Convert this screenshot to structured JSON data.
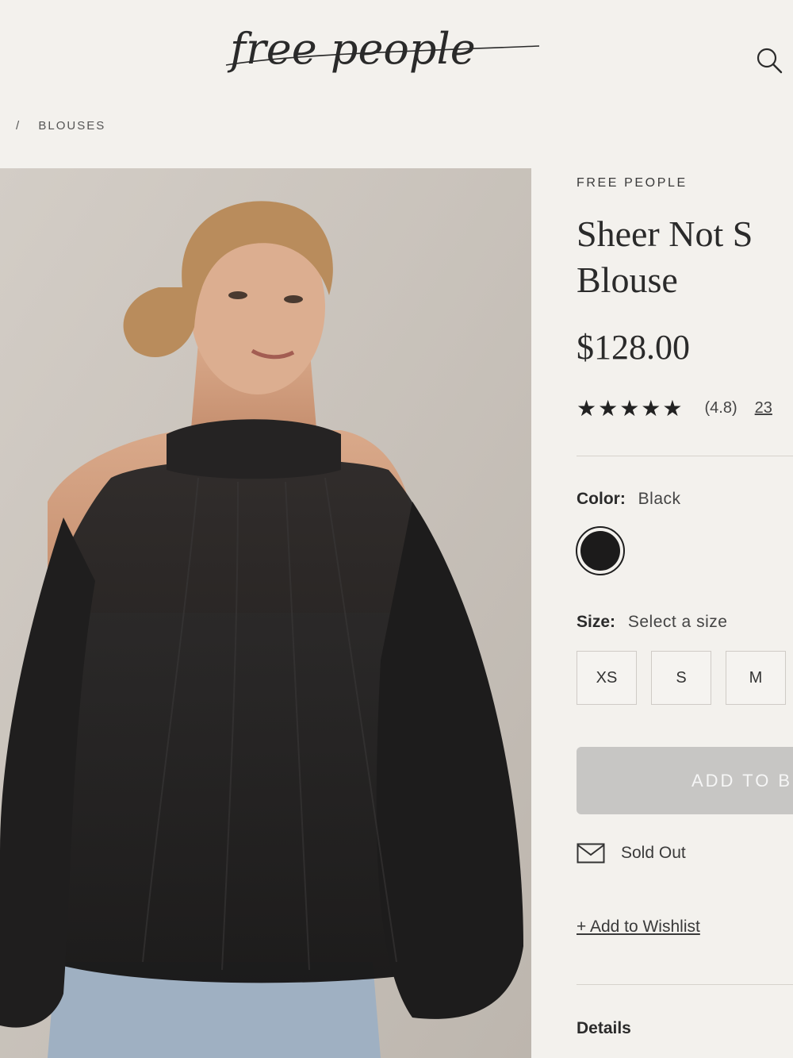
{
  "header": {
    "logo_text": "free people",
    "search_icon": "search-icon"
  },
  "breadcrumb": {
    "separator": "/",
    "current": "BLOUSES"
  },
  "product": {
    "brand": "FREE PEOPLE",
    "title": "Sheer Not S Blouse",
    "title_line1": "Sheer Not S",
    "title_line2": "Blouse",
    "price": "$128.00",
    "rating_stars": 5,
    "rating_value": "(4.8)",
    "review_count": "23",
    "color_label": "Color:",
    "color_value": "Black",
    "swatch_color": "#1c1b1b",
    "size_label": "Size:",
    "size_value": "Select a size",
    "sizes": [
      "XS",
      "S",
      "M"
    ],
    "add_to_bag": "ADD TO B",
    "sold_out": "Sold Out",
    "wishlist": "+ Add to Wishlist",
    "details": "Details"
  },
  "colors": {
    "background": "#f3f1ed",
    "button_disabled": "#c7c6c4",
    "text": "#2b2b2b"
  }
}
